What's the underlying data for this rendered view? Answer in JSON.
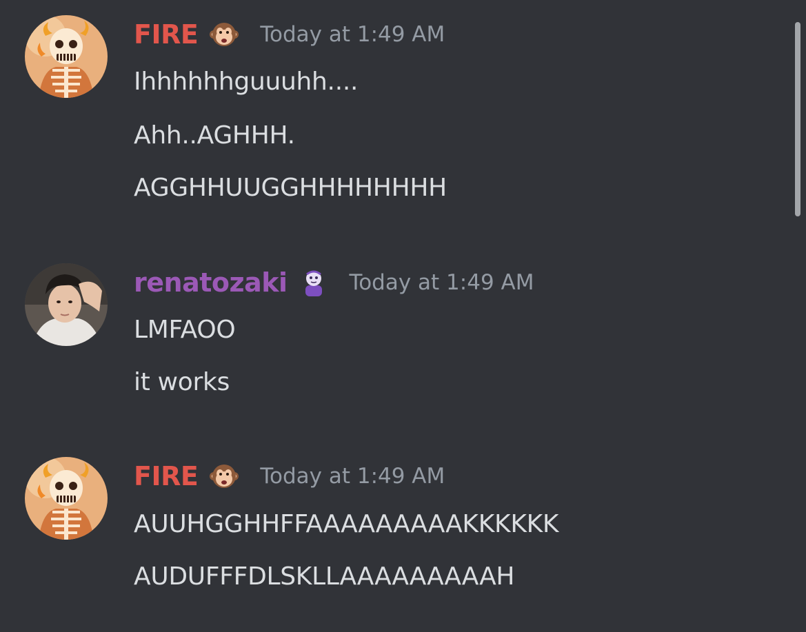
{
  "colors": {
    "background": "#313338",
    "fire_name": "#e2564c",
    "renatozaki_name": "#9b59b6",
    "timestamp": "#949ba4",
    "message_text": "#dbdee1"
  },
  "messages": [
    {
      "username": "FIRE",
      "role_icon": "monkey-face-icon",
      "timestamp": "Today at 1:49 AM",
      "lines": [
        "Ihhhhhhguuuhh....",
        "Ahh..AGHHH.",
        "AGGHHUUGGHHHHHHHH"
      ]
    },
    {
      "username": "renatozaki",
      "role_icon": "purple-creature-icon",
      "timestamp": "Today at 1:49 AM",
      "lines": [
        "LMFAOO",
        "it works"
      ]
    },
    {
      "username": "FIRE",
      "role_icon": "monkey-face-icon",
      "timestamp": "Today at 1:49 AM",
      "lines": [
        "AUUHGGHHFFAAAAAAAAAKKKKKK",
        "AUDUFFFDLSKLLAAAAAAAAAH"
      ]
    }
  ]
}
